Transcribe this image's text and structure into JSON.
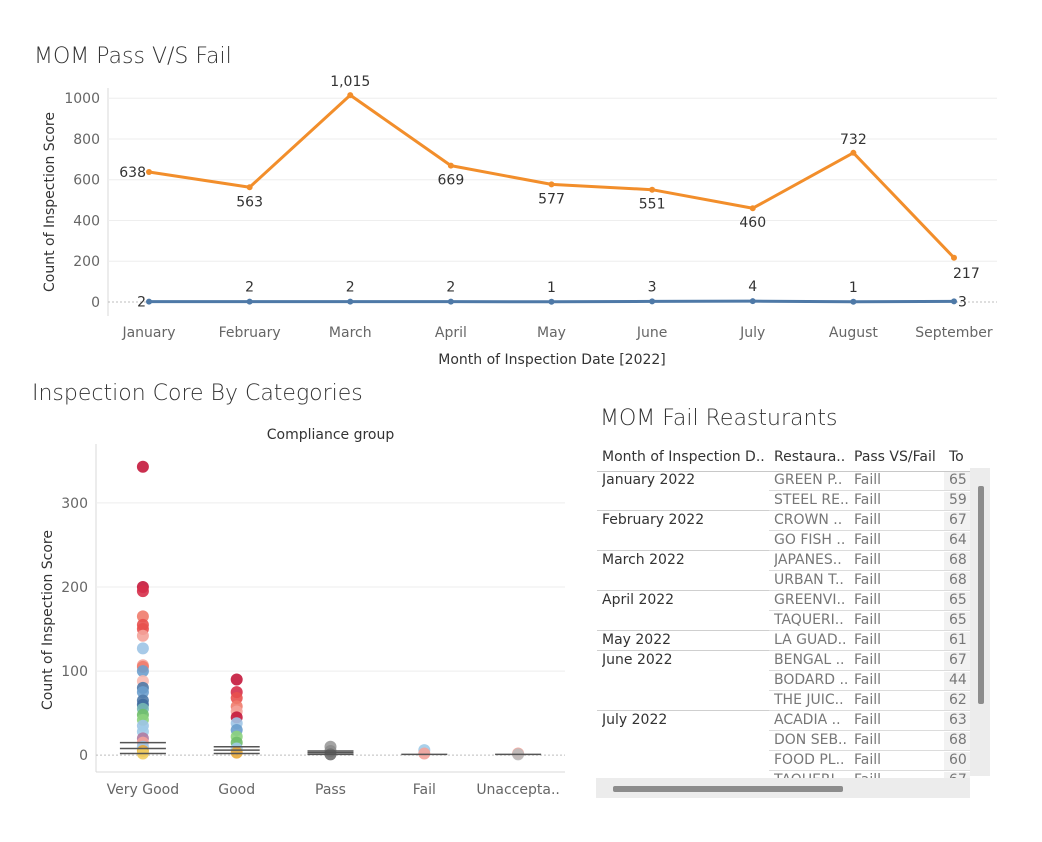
{
  "titles": {
    "line_chart": "MOM Pass V/S Fail",
    "strip_chart": "Inspection Core By Categories",
    "table": "MOM Fail Reasturants"
  },
  "chart_data": [
    {
      "type": "line",
      "title": "MOM Pass V/S Fail",
      "xlabel": "Month of Inspection Date [2022]",
      "ylabel": "Count of Inspection Score",
      "categories": [
        "January",
        "February",
        "March",
        "April",
        "May",
        "June",
        "July",
        "August",
        "September"
      ],
      "ylim": [
        0,
        1050
      ],
      "yticks": [
        0,
        200,
        400,
        600,
        800,
        1000
      ],
      "ytick_labels": [
        "0",
        "200",
        "400",
        "600",
        "800",
        "1000"
      ],
      "grid": true,
      "series": [
        {
          "color": "#F28E2B",
          "values": [
            638,
            563,
            1015,
            669,
            577,
            551,
            460,
            732,
            217
          ],
          "labels": [
            "638",
            "563",
            "1,015",
            "669",
            "577",
            "551",
            "460",
            "732",
            "217"
          ]
        },
        {
          "color": "#4E79A7",
          "values": [
            2,
            2,
            2,
            2,
            1,
            3,
            4,
            1,
            3
          ],
          "labels": [
            "2",
            "2",
            "2",
            "2",
            "1",
            "3",
            "4",
            "1",
            "3"
          ]
        }
      ]
    },
    {
      "type": "scatter",
      "title": "Compliance group",
      "ylabel": "Count of Inspection Score",
      "categories": [
        "Very Good",
        "Good",
        "Pass",
        "Fail",
        "Unaccepta.."
      ],
      "ylim": [
        -20,
        370
      ],
      "yticks": [
        0,
        100,
        200,
        300
      ],
      "ytick_labels": [
        "0",
        "100",
        "200",
        "300"
      ],
      "points": [
        {
          "cat": 0,
          "y": 343,
          "c": "#C4183C"
        },
        {
          "cat": 0,
          "y": 200,
          "c": "#C4183C"
        },
        {
          "cat": 0,
          "y": 195,
          "c": "#D62F4A"
        },
        {
          "cat": 0,
          "y": 165,
          "c": "#F07B6B"
        },
        {
          "cat": 0,
          "y": 155,
          "c": "#E8514E"
        },
        {
          "cat": 0,
          "y": 150,
          "c": "#E8514E"
        },
        {
          "cat": 0,
          "y": 142,
          "c": "#F4A39A"
        },
        {
          "cat": 0,
          "y": 127,
          "c": "#9DC4E6"
        },
        {
          "cat": 0,
          "y": 107,
          "c": "#F4A39A"
        },
        {
          "cat": 0,
          "y": 105,
          "c": "#F07B6B"
        },
        {
          "cat": 0,
          "y": 100,
          "c": "#6C9FCD"
        },
        {
          "cat": 0,
          "y": 88,
          "c": "#F8B9B0"
        },
        {
          "cat": 0,
          "y": 80,
          "c": "#4E79A7"
        },
        {
          "cat": 0,
          "y": 75,
          "c": "#6C9FCD"
        },
        {
          "cat": 0,
          "y": 65,
          "c": "#4E79A7"
        },
        {
          "cat": 0,
          "y": 60,
          "c": "#3F6C9E"
        },
        {
          "cat": 0,
          "y": 55,
          "c": "#76B7B2"
        },
        {
          "cat": 0,
          "y": 48,
          "c": "#6FBE6A"
        },
        {
          "cat": 0,
          "y": 42,
          "c": "#8CD17D"
        },
        {
          "cat": 0,
          "y": 35,
          "c": "#9DC4E6"
        },
        {
          "cat": 0,
          "y": 28,
          "c": "#A0CBE8"
        },
        {
          "cat": 0,
          "y": 20,
          "c": "#B07AA1"
        },
        {
          "cat": 0,
          "y": 15,
          "c": "#F4A39A"
        },
        {
          "cat": 0,
          "y": 10,
          "c": "#9DC4E6"
        },
        {
          "cat": 0,
          "y": 5,
          "c": "#E8A838"
        },
        {
          "cat": 0,
          "y": 2,
          "c": "#F1CE63"
        },
        {
          "cat": 1,
          "y": 90,
          "c": "#C4183C"
        },
        {
          "cat": 1,
          "y": 75,
          "c": "#D62F4A"
        },
        {
          "cat": 1,
          "y": 68,
          "c": "#E8514E"
        },
        {
          "cat": 1,
          "y": 58,
          "c": "#F07B6B"
        },
        {
          "cat": 1,
          "y": 52,
          "c": "#F4A39A"
        },
        {
          "cat": 1,
          "y": 45,
          "c": "#C4183C"
        },
        {
          "cat": 1,
          "y": 38,
          "c": "#9DC4E6"
        },
        {
          "cat": 1,
          "y": 30,
          "c": "#6C9FCD"
        },
        {
          "cat": 1,
          "y": 22,
          "c": "#8CD17D"
        },
        {
          "cat": 1,
          "y": 15,
          "c": "#6FBE6A"
        },
        {
          "cat": 1,
          "y": 8,
          "c": "#A0CBE8"
        },
        {
          "cat": 1,
          "y": 3,
          "c": "#E8A838"
        },
        {
          "cat": 2,
          "y": 10,
          "c": "#9A9A9A"
        },
        {
          "cat": 2,
          "y": 5,
          "c": "#8C8C8C"
        },
        {
          "cat": 2,
          "y": 1,
          "c": "#6E6E6E"
        },
        {
          "cat": 3,
          "y": 6,
          "c": "#A0CBE8"
        },
        {
          "cat": 3,
          "y": 2,
          "c": "#F4A39A"
        },
        {
          "cat": 4,
          "y": 2,
          "c": "#F4A39A"
        },
        {
          "cat": 4,
          "y": 1,
          "c": "#BBBBBB"
        }
      ],
      "whiskers": [
        {
          "cat": 0,
          "values": [
            15,
            8,
            2
          ]
        },
        {
          "cat": 1,
          "values": [
            10,
            6,
            2
          ]
        },
        {
          "cat": 2,
          "values": [
            5,
            3,
            1
          ]
        },
        {
          "cat": 3,
          "values": [
            1
          ]
        },
        {
          "cat": 4,
          "values": [
            1
          ]
        }
      ]
    }
  ],
  "table": {
    "columns": [
      "Month of Inspection D..",
      "Restaura..",
      "Pass VS/Fail",
      "To"
    ],
    "rows": [
      {
        "month": "January 2022",
        "rest": "GREEN P..",
        "pf": "Faill",
        "total": "65"
      },
      {
        "month": "",
        "rest": "STEEL RE..",
        "pf": "Faill",
        "total": "59"
      },
      {
        "month": "February 2022",
        "rest": "CROWN ..",
        "pf": "Faill",
        "total": "67"
      },
      {
        "month": "",
        "rest": "GO FISH ..",
        "pf": "Faill",
        "total": "64"
      },
      {
        "month": "March 2022",
        "rest": "JAPANES..",
        "pf": "Faill",
        "total": "68"
      },
      {
        "month": "",
        "rest": "URBAN T..",
        "pf": "Faill",
        "total": "68"
      },
      {
        "month": "April 2022",
        "rest": "GREENVI..",
        "pf": "Faill",
        "total": "65"
      },
      {
        "month": "",
        "rest": "TAQUERI..",
        "pf": "Faill",
        "total": "65"
      },
      {
        "month": "May 2022",
        "rest": "LA GUAD..",
        "pf": "Faill",
        "total": "61"
      },
      {
        "month": "June 2022",
        "rest": "BENGAL ..",
        "pf": "Faill",
        "total": "67"
      },
      {
        "month": "",
        "rest": "BODARD ..",
        "pf": "Faill",
        "total": "44"
      },
      {
        "month": "",
        "rest": "THE JUIC..",
        "pf": "Faill",
        "total": "62"
      },
      {
        "month": "July 2022",
        "rest": "ACADIA ..",
        "pf": "Faill",
        "total": "63"
      },
      {
        "month": "",
        "rest": "DON SEB..",
        "pf": "Faill",
        "total": "68"
      },
      {
        "month": "",
        "rest": "FOOD PL..",
        "pf": "Faill",
        "total": "60"
      },
      {
        "month": "",
        "rest": "TAQUERI..",
        "pf": "Faill",
        "total": "67"
      }
    ]
  }
}
